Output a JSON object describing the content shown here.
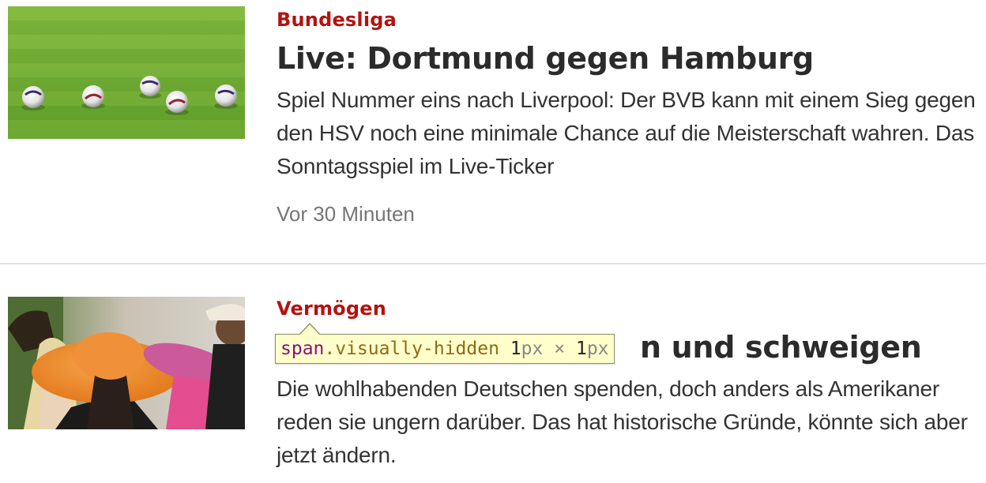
{
  "articles": [
    {
      "kicker": "Bundesliga",
      "headline": "Live: Dortmund gegen Hamburg",
      "teaser": "Spiel Nummer eins nach Liverpool: Der BVB kann mit einem Sieg gegen den HSV noch eine minimale Chance auf die Meisterschaft wahren. Das Sonntagsspiel im Live-Ticker",
      "timestamp": "Vor 30 Minuten",
      "image": "soccer-balls-on-grass"
    },
    {
      "kicker": "Vermögen",
      "headline_visible": "n und schweigen",
      "teaser": "Die wohlhabenden Deutschen spenden, doch anders als Amerikaner reden sie ungern darüber. Das hat historische Gründe, könnte sich aber jetzt ändern.",
      "image": "woman-in-orange-hat"
    }
  ],
  "devtools_tooltip": {
    "tag": "span",
    "class": ".visually-hidden",
    "width": "1",
    "height": "1",
    "unit": "px",
    "separator": "×"
  },
  "colors": {
    "kicker": "#b5120f",
    "headline": "#2b2b2b",
    "teaser": "#333333",
    "timestamp": "#757575",
    "tooltip_bg": "#ffffcc"
  }
}
